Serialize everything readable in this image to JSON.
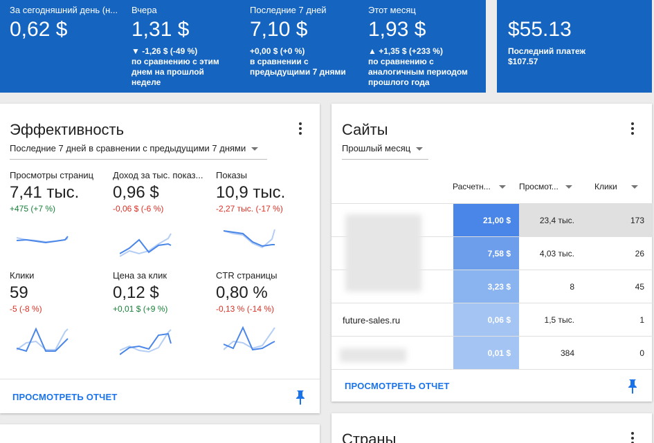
{
  "stats": [
    {
      "label": "За сегодняшний день (н...",
      "value": "0,62 $",
      "delta": "",
      "compare": ""
    },
    {
      "label": "Вчера",
      "value": "1,31 $",
      "delta": "▼ -1,26 $ (-49 %)",
      "compare": "по сравнению с этим днем на прошлой неделе"
    },
    {
      "label": "Последние 7 дней",
      "value": "7,10 $",
      "delta": "+0,00 $ (+0 %)",
      "compare": "в сравнении с предыдущими 7 днями"
    },
    {
      "label": "Этот месяц",
      "value": "1,93 $",
      "delta": "▲ +1,35 $ (+233 %)",
      "compare": "по сравнению с аналогичным периодом прошлого года"
    }
  ],
  "balance": {
    "value": "$55.13",
    "label": "Последний платеж",
    "amount": "$107.57"
  },
  "performance": {
    "title": "Эффективность",
    "period": "Последние 7 дней в сравнении с предыдущими 7 днями",
    "metrics": [
      {
        "label": "Просмотры страниц",
        "value": "7,41 тыс.",
        "delta": "+475 (+7 %)",
        "trend": "up"
      },
      {
        "label": "Доход за тыс. показ...",
        "value": "0,96 $",
        "delta": "-0,06 $ (-6 %)",
        "trend": "down"
      },
      {
        "label": "Показы",
        "value": "10,9 тыс.",
        "delta": "-2,27 тыс. (-17 %)",
        "trend": "down"
      },
      {
        "label": "Клики",
        "value": "59",
        "delta": "-5 (-8 %)",
        "trend": "down"
      },
      {
        "label": "Цена за клик",
        "value": "0,12 $",
        "delta": "+0,01 $ (+9 %)",
        "trend": "up"
      },
      {
        "label": "CTR страницы",
        "value": "0,80 %",
        "delta": "-0,13 % (-14 %)",
        "trend": "down"
      }
    ],
    "report_link": "ПРОСМОТРЕТЬ ОТЧЕТ"
  },
  "sites": {
    "title": "Сайты",
    "period": "Прошлый месяц",
    "columns": [
      "Расчетн...",
      "Просмот...",
      "Клики"
    ],
    "rows": [
      {
        "site": "",
        "revenue": "21,00 $",
        "views": "23,4 тыс.",
        "clicks": "173"
      },
      {
        "site": "",
        "revenue": "7,58 $",
        "views": "4,03 тыс.",
        "clicks": "26"
      },
      {
        "site": "",
        "revenue": "3,23 $",
        "views": "8",
        "clicks": "45"
      },
      {
        "site": "future-sales.ru",
        "revenue": "0,06 $",
        "views": "1,5 тыс.",
        "clicks": "1"
      },
      {
        "site": "",
        "revenue": "0,01 $",
        "views": "384",
        "clicks": "0"
      }
    ],
    "report_link": "ПРОСМОТРЕТЬ ОТЧЕТ"
  },
  "countries": {
    "title": "Страны"
  },
  "colors": {
    "banner": "#1565c0",
    "up": "#188038",
    "down": "#d93025",
    "link": "#1a73e8",
    "rev_heat": [
      "#4a86e8",
      "#6d9eeb",
      "#8ab4f0",
      "#a4c4f4",
      "#a4c4f4"
    ]
  }
}
